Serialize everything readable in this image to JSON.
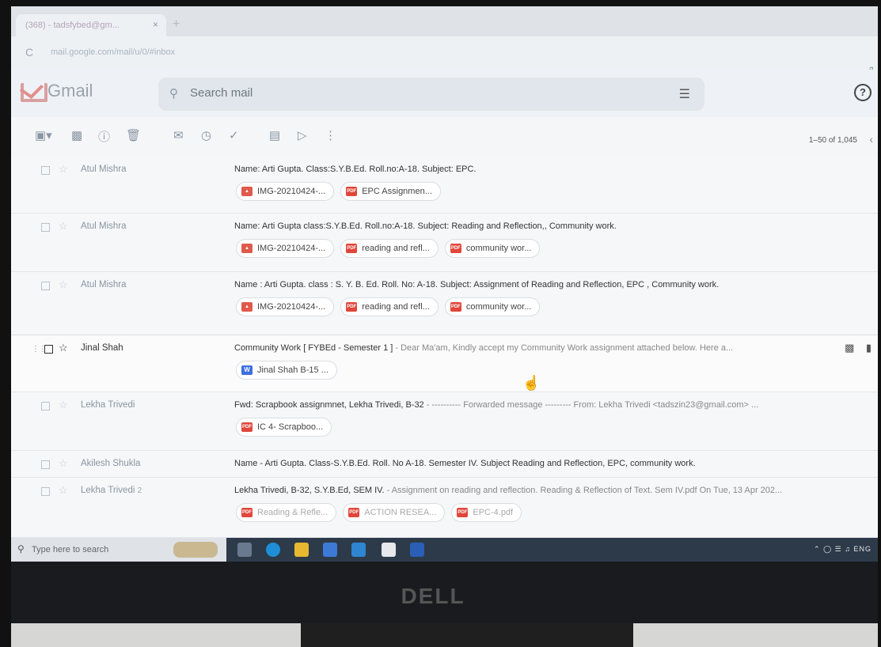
{
  "browser": {
    "tab_title": "(368) - tadsfybed@gm...",
    "tab_close": "×",
    "new_tab": "+",
    "url": "mail.google.com/mail/u/0/#inbox"
  },
  "gmail": {
    "logo_text": "Gmail",
    "search_placeholder": "Search mail",
    "pager": "1–50 of 1,045"
  },
  "emails": [
    {
      "sender": "Atul Mishra",
      "subject": "Name: Arti Gupta. Class:S.Y.B.Ed. Roll.no:A-18. Subject: EPC.",
      "snippet": "",
      "attachments": [
        {
          "type": "img",
          "name": "IMG-20210424-..."
        },
        {
          "type": "pdf",
          "name": "EPC Assignmen..."
        }
      ]
    },
    {
      "sender": "Atul Mishra",
      "subject": "Name: Arti Gupta class:S.Y.B.Ed. Roll.no:A-18. Subject: Reading and Reflection,, Community work.",
      "snippet": "",
      "attachments": [
        {
          "type": "img",
          "name": "IMG-20210424-..."
        },
        {
          "type": "pdf",
          "name": "reading and refl..."
        },
        {
          "type": "pdf",
          "name": "community wor..."
        }
      ]
    },
    {
      "sender": "Atul Mishra",
      "subject": "Name : Arti Gupta. class : S. Y. B. Ed. Roll. No: A-18. Subject: Assignment of Reading and Reflection, EPC , Community work.",
      "snippet": "",
      "attachments": [
        {
          "type": "img",
          "name": "IMG-20210424-..."
        },
        {
          "type": "pdf",
          "name": "reading and refl..."
        },
        {
          "type": "pdf",
          "name": "community wor..."
        }
      ]
    },
    {
      "sender": "Jinal Shah",
      "subject": "Community Work [ FYBEd - Semester 1 ]",
      "snippet": " - Dear Ma'am, Kindly accept my Community Work assignment attached below. Here a...",
      "attachments": [
        {
          "type": "doc",
          "name": "Jinal Shah B-15 ..."
        }
      ]
    },
    {
      "sender": "Lekha Trivedi",
      "subject": "Fwd: Scrapbook assignmnet, Lekha Trivedi, B-32",
      "snippet": " - ---------- Forwarded message --------- From: Lekha Trivedi <tadszin23@gmail.com> ...",
      "attachments": [
        {
          "type": "pdf",
          "name": "IC 4- Scrapboo..."
        }
      ]
    },
    {
      "sender": "Akilesh Shukla",
      "subject": "Name - Arti Gupta. Class-S.Y.B.Ed. Roll. No A-18. Semester IV. Subject Reading and Reflection, EPC, community work.",
      "snippet": "",
      "attachments": []
    },
    {
      "sender": "Lekha Trivedi",
      "sender_count": "2",
      "subject": "Lekha Trivedi, B-32, S.Y.B.Ed, SEM IV.",
      "snippet": " - Assignment on reading and reflection. Reading & Reflection of Text. Sem IV.pdf On Tue, 13 Apr 202...",
      "attachments": [
        {
          "type": "pdf",
          "name": "Reading & Refle..."
        },
        {
          "type": "pdf",
          "name": "ACTION RESEA..."
        },
        {
          "type": "pdf",
          "name": "EPC-4.pdf"
        }
      ]
    }
  ],
  "taskbar": {
    "search_text": "Type here to search",
    "tray_text": "ENG"
  },
  "monitor": {
    "brand": "DELL"
  },
  "colors": {
    "pdf": "#e0463a",
    "img": "#e05a4c",
    "doc": "#3d6ee0",
    "gmail_red": "#e28e8e"
  }
}
